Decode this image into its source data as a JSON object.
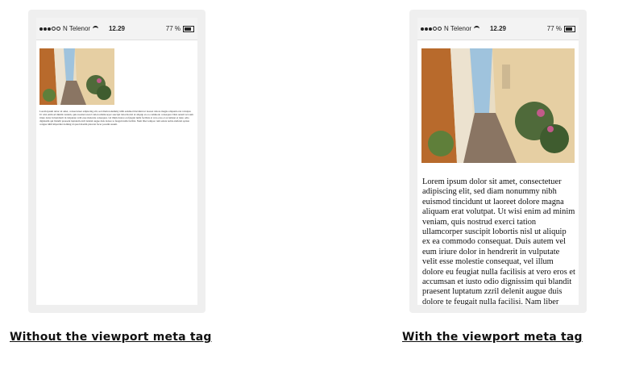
{
  "status_bar": {
    "carrier": "N Telenor",
    "time": "12.29",
    "battery": "77 %"
  },
  "left_phone": {
    "body_text": "Lorem ipsum dolor sit amet, consectetuer adipiscing elit, sed diam nonummy nibh euismod tincidunt ut laoreet dolore magna aliquam erat volutpat. Ut wisi enim ad minim veniam, quis nostrud exerci tation ullamcorper suscipit lobortis nisl ut aliquip ex ea commodo consequat. Duis autem vel eum iriure dolor in hendrerit in vulputate velit esse molestie consequat, vel illum dolore eu feugiat nulla facilisis at vero eros et accumsan et iusto odio dignissim qui blandit praesent luptatum zzril delenit augue duis dolore te feugait nulla facilisi. Nam liber tempor cum soluta nobis eleifend option congue nihil imperdiet doming id quod mazim placerat facer possim assum."
  },
  "right_phone": {
    "body_text": "Lorem ipsum dolor sit amet, consectetuer adipiscing elit, sed diam nonummy nibh euismod tincidunt ut laoreet dolore magna aliquam erat volutpat. Ut wisi enim ad minim veniam, quis nostrud exerci tation ullamcorper suscipit lobortis nisl ut aliquip ex ea commodo consequat. Duis autem vel eum iriure dolor in hendrerit in vulputate velit esse molestie consequat, vel illum dolore eu feugiat nulla facilisis at vero eros et accumsan et iusto odio dignissim qui blandit praesent luptatum zzril delenit augue duis dolore te feugait nulla facilisi. Nam liber tempor cum soluta nobis eleifend option congue nihil imperdiet doming"
  },
  "captions": {
    "left": "Without the viewport meta tag",
    "right": "With the viewport meta tag"
  }
}
